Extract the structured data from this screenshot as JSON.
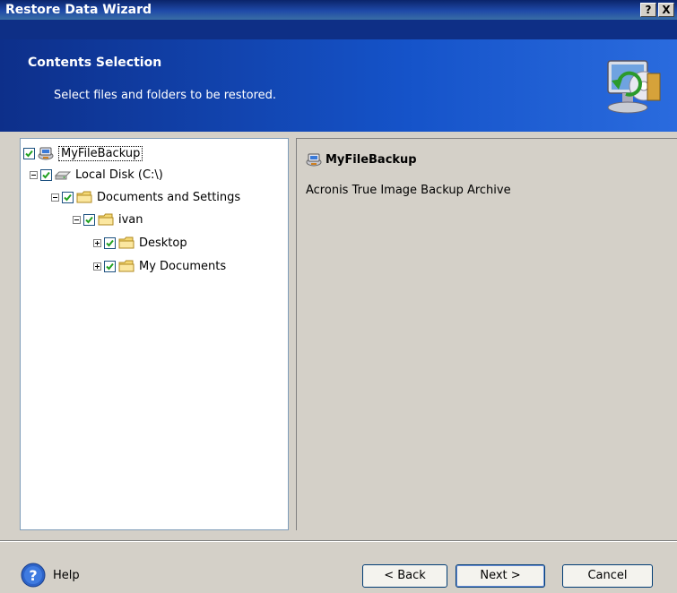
{
  "window": {
    "title": "Restore Data Wizard",
    "help_glyph": "?",
    "close_glyph": "X"
  },
  "header": {
    "title": "Contents Selection",
    "subtitle": "Select files and folders to be restored."
  },
  "tree": {
    "items": [
      {
        "label": "MyFileBackup",
        "checked": true,
        "icon": "backup-archive-icon"
      },
      {
        "label": "Local Disk (C:\\)",
        "checked": true,
        "icon": "drive-icon",
        "expander": "minus"
      },
      {
        "label": "Documents and Settings",
        "checked": true,
        "icon": "folder-icon",
        "expander": "minus"
      },
      {
        "label": "ivan",
        "checked": true,
        "icon": "folder-icon",
        "expander": "minus"
      },
      {
        "label": "Desktop",
        "checked": true,
        "icon": "folder-icon",
        "expander": "plus"
      },
      {
        "label": "My Documents",
        "checked": true,
        "icon": "folder-icon",
        "expander": "plus"
      }
    ]
  },
  "details": {
    "title": "MyFileBackup",
    "description": "Acronis True Image Backup Archive"
  },
  "footer": {
    "help_label": "Help",
    "back_label": "< Back",
    "next_label": "Next >",
    "cancel_label": "Cancel"
  },
  "colors": {
    "header_blue": "#1553c9",
    "title_blue": "#0a246a",
    "checkbox_green": "#21a121"
  }
}
